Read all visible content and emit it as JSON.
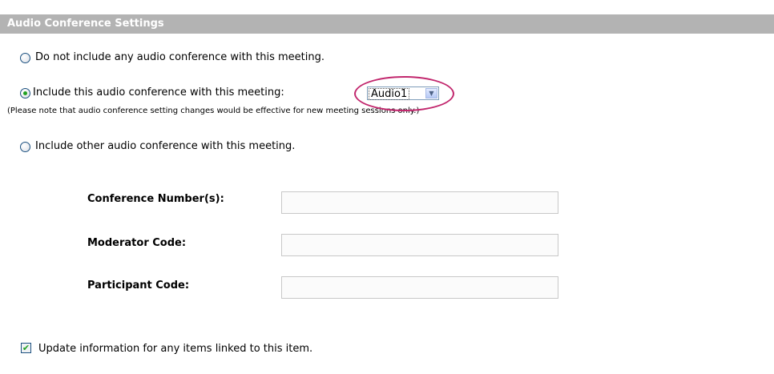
{
  "header": {
    "title": "Audio Conference Settings"
  },
  "options": {
    "none_label": "Do not include any audio conference with this meeting.",
    "include_label": "Include this audio conference with this meeting:",
    "include_select_value": "Audio1",
    "note": "(Please note that audio conference setting changes would be effective for new meeting sessions only.)",
    "other_label": "Include other audio conference with this meeting.",
    "selected": "include"
  },
  "fields": {
    "conference_number": {
      "label": "Conference Number(s):",
      "value": ""
    },
    "moderator_code": {
      "label": "Moderator Code:",
      "value": ""
    },
    "participant_code": {
      "label": "Participant Code:",
      "value": ""
    }
  },
  "update_linked": {
    "label": "Update information for any items linked to this item.",
    "checked": true
  },
  "colors": {
    "header_bg": "#b3b3b3",
    "highlight": "#c2286e",
    "radio_check": "#21a121"
  },
  "icons": {
    "select_arrow": "chevron-down-icon",
    "checkbox_mark": "checkmark-icon"
  }
}
